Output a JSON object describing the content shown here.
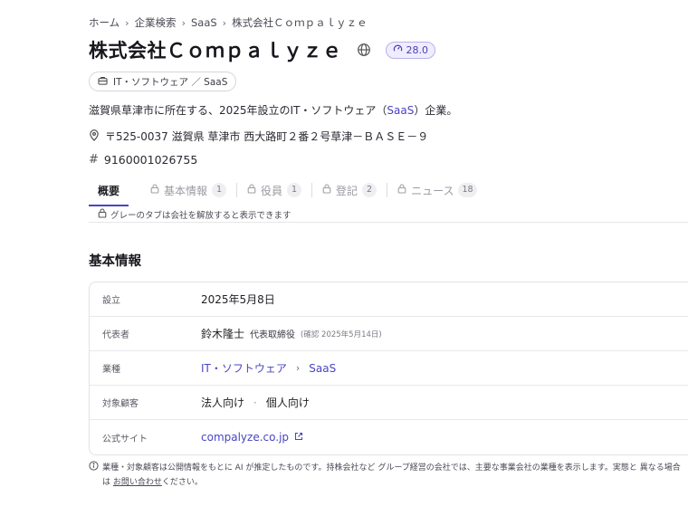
{
  "breadcrumb": {
    "items": [
      "ホーム",
      "企業検索",
      "SaaS",
      "株式会社Ｃｏｍｐａｌｙｚｅ"
    ]
  },
  "company": {
    "name": "株式会社Ｃｏｍｐａｌｙｚｅ",
    "score": "28.0",
    "category_tag": "IT・ソフトウェア ／ SaaS",
    "description_prefix": "滋賀県草津市に所在する、2025年設立のIT・ソフトウェア（",
    "description_link": "SaaS",
    "description_suffix": "）企業。",
    "address": "〒525-0037 滋賀県 草津市 西大路町２番２号草津－ＢＡＳＥ－９",
    "corporate_number": "9160001026755"
  },
  "tabs": {
    "items": [
      {
        "label": "概要",
        "count": ""
      },
      {
        "label": "基本情報",
        "count": "1"
      },
      {
        "label": "役員",
        "count": "1"
      },
      {
        "label": "登記",
        "count": "2"
      },
      {
        "label": "ニュース",
        "count": "18"
      }
    ],
    "note": "グレーのタブは会社を解放すると表示できます"
  },
  "basic_info": {
    "title": "基本情報",
    "rows": {
      "founded": {
        "label": "設立",
        "value": "2025年5月8日"
      },
      "representative": {
        "label": "代表者",
        "name": "鈴木隆士",
        "role": "代表取締役",
        "confirmed": "(確認 2025年5月14日)"
      },
      "industry": {
        "label": "業種",
        "primary": "IT・ソフトウェア",
        "secondary": "SaaS"
      },
      "customers": {
        "label": "対象顧客",
        "first": "法人向け",
        "second": "個人向け"
      },
      "website": {
        "label": "公式サイト",
        "value": "compalyze.co.jp"
      }
    }
  },
  "footnote": {
    "line1": "業種・対象顧客は公開情報をもとに AI が推定したものです。持株会社など グループ経営の会社では、主要な事業会社の業種を表示します。実態と 異なる場合",
    "line2_prefix": "は ",
    "line2_link": "お問い合わせ",
    "line2_suffix": "ください。"
  },
  "colors": {
    "accent": "#4a44c4",
    "score_bg": "#efedfd",
    "muted": "#9a9aa3"
  }
}
